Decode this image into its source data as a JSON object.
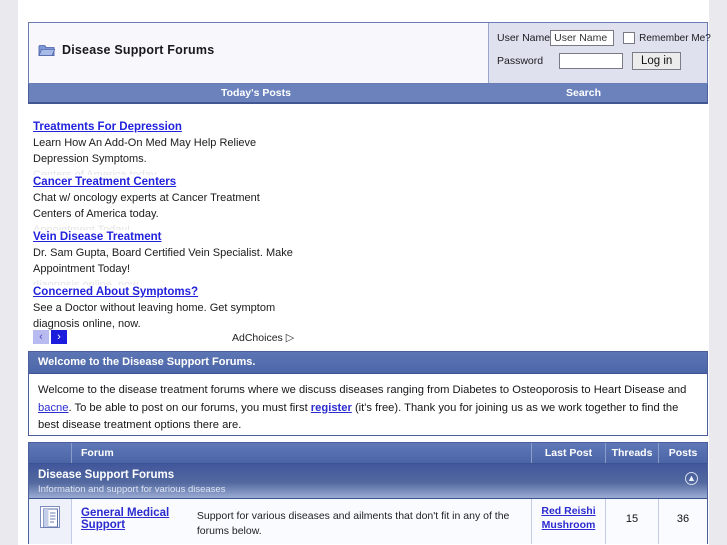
{
  "site": {
    "title": "Disease Support Forums",
    "logo_icon": "folder-icon"
  },
  "login": {
    "username_label": "User Name",
    "username_value": "User Name",
    "password_label": "Password",
    "password_value": "",
    "remember_label": "Remember Me?",
    "login_button": "Log in"
  },
  "nav": {
    "todays_posts": "Today's Posts",
    "search": "Search"
  },
  "ads": {
    "adchoices_label": "AdChoices",
    "prev_arrow": "‹",
    "next_arrow": "›",
    "items": [
      {
        "title": "Treatments For Depression",
        "line1": "Learn How An Add-On Med May Help Relieve",
        "line2": "Depression Symptoms."
      },
      {
        "title": "Cancer Treatment Centers",
        "line1": "Chat w/ oncology experts at Cancer Treatment",
        "line2": "Centers of America today."
      },
      {
        "title": "Vein Disease Treatment",
        "line1": "Dr. Sam Gupta, Board Certified Vein Specialist. Make",
        "line2": "Appointment Today!"
      },
      {
        "title": "Concerned About Symptoms?",
        "line1": "See a Doctor without leaving home. Get symptom",
        "line2": "diagnosis online, now."
      }
    ]
  },
  "welcome": {
    "heading": "Welcome to the Disease Support Forums.",
    "text_part1": "Welcome to the disease treatment forums where we discuss diseases ranging from Diabetes to Osteoporosis to Heart Disease and ",
    "link_bacne": "bacne",
    "text_part2": ". To be able to post on our forums, you must first ",
    "link_register": "register",
    "text_part3": " (it's free). Thank you for joining us as we work together to find the best disease treatment options there are."
  },
  "forum_table": {
    "columns": {
      "forum": "Forum",
      "last_post": "Last Post",
      "threads": "Threads",
      "posts": "Posts"
    },
    "category": {
      "title": "Disease Support Forums",
      "subtitle": "Information and support for various diseases",
      "collapse_icon": "chevron-up-icon"
    },
    "rows": [
      {
        "icon": "document-icon",
        "name": "General Medical Support",
        "description": "Support for various diseases and ailments that don't fit in any of the forums below.",
        "last_post_line1": "Red Reishi",
        "last_post_line2": "Mushroom",
        "threads": "15",
        "posts": "36"
      }
    ]
  },
  "colors": {
    "header_border": "#6a7bb5",
    "nav_bar": "#6b82bd",
    "category_bar": "#41579c",
    "link_blue": "#2b2bd0",
    "ad_link_blue": "#2222dd",
    "page_bg": "#e9e9ee"
  }
}
